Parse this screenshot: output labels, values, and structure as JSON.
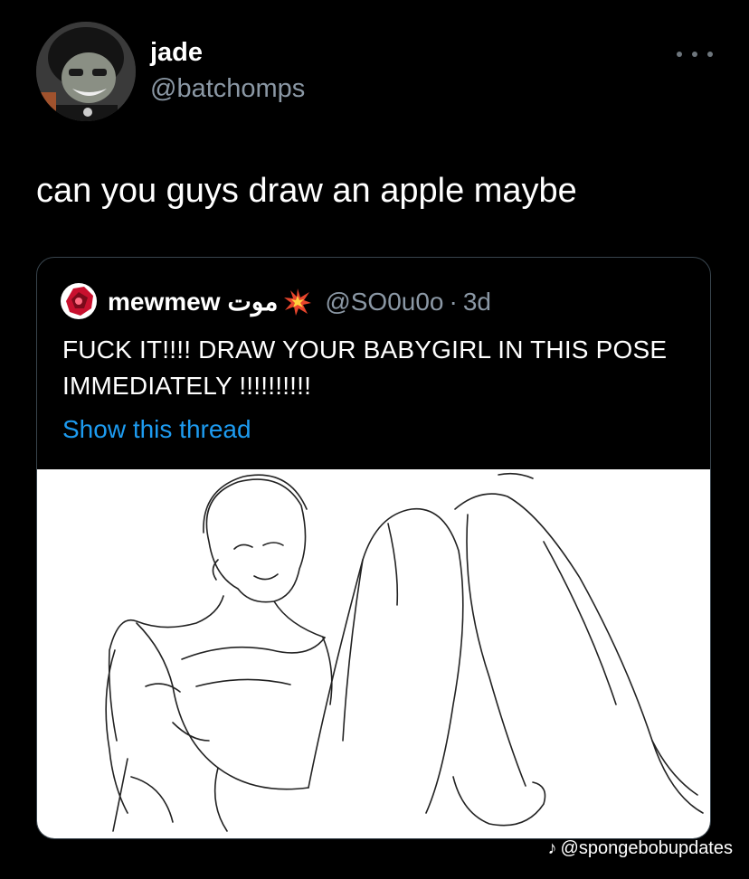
{
  "tweet": {
    "display_name": "jade",
    "handle": "@batchomps",
    "text": "can you guys draw an apple maybe",
    "more_icon": "more-horizontal-icon"
  },
  "quote": {
    "display_name": "mewmew",
    "name_suffix": "موت",
    "emoji_icon": "collision-icon",
    "handle": "@SO0u0o",
    "separator": "·",
    "time": "3d",
    "text": "FUCK IT!!!! DRAW YOUR BABYGIRL IN THIS POSE IMMEDIATELY !!!!!!!!!!",
    "show_thread": "Show this thread",
    "image": "pose-sketch-image"
  },
  "watermark": {
    "icon": "tiktok-icon",
    "text": "@spongebobupdates"
  },
  "colors": {
    "background": "#000000",
    "text": "#ffffff",
    "muted": "#8b98a5",
    "link": "#1d9bf0",
    "border": "#38444d"
  }
}
